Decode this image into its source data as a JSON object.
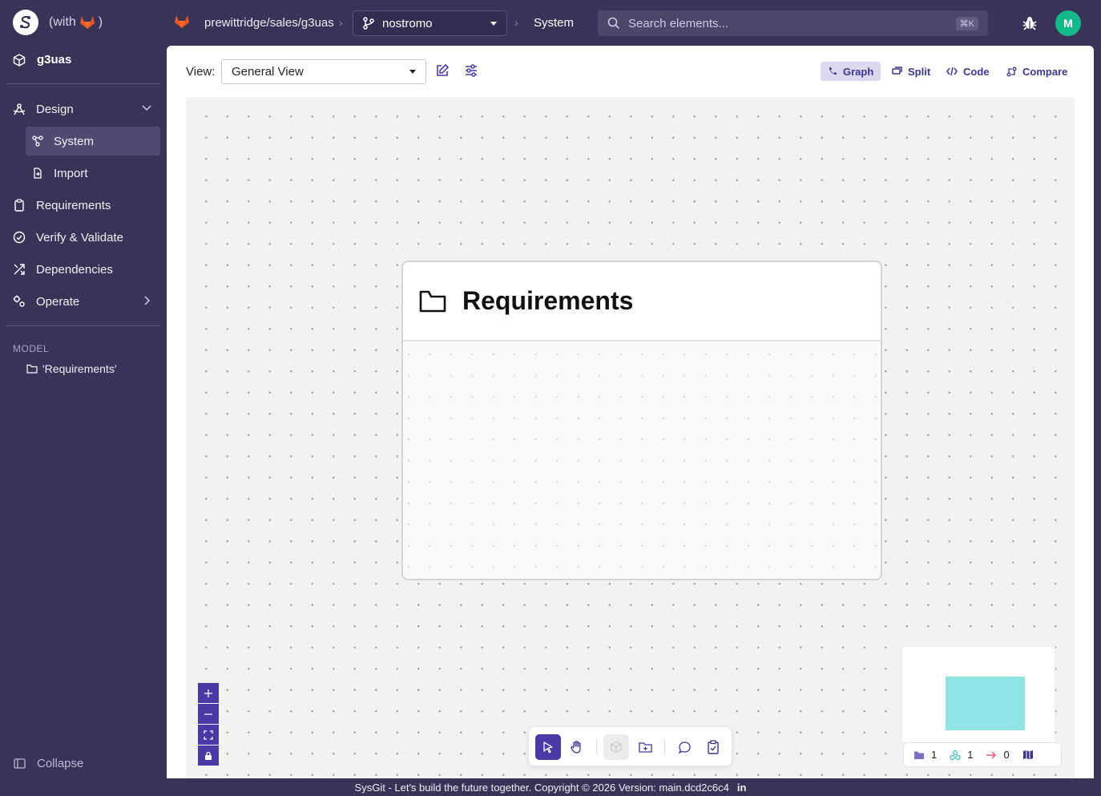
{
  "app": {
    "with_label_open": "(with",
    "with_label_close": ")"
  },
  "topbar": {
    "repo_path": "prewittridge/sales/g3uas",
    "branch": "nostromo",
    "breadcrumb_current": "System",
    "search_placeholder": "Search elements...",
    "search_shortcut": "⌘K",
    "avatar_initial": "M"
  },
  "sidebar": {
    "project": "g3uas",
    "items": [
      {
        "label": "Design"
      },
      {
        "label": "System"
      },
      {
        "label": "Import"
      },
      {
        "label": "Requirements"
      },
      {
        "label": "Verify & Validate"
      },
      {
        "label": "Dependencies"
      },
      {
        "label": "Operate"
      }
    ],
    "model_heading": "MODEL",
    "model_items": [
      {
        "label": "'Requirements'"
      }
    ],
    "collapse_label": "Collapse"
  },
  "toolbar": {
    "view_label": "View:",
    "view_selected": "General View",
    "modes": [
      {
        "label": "Graph",
        "active": true
      },
      {
        "label": "Split"
      },
      {
        "label": "Code"
      },
      {
        "label": "Compare"
      }
    ]
  },
  "canvas": {
    "package_title": "Requirements",
    "stats": {
      "packages": "1",
      "elements": "1",
      "relations": "0"
    }
  },
  "footer": {
    "text": "SysGit - Let's build the future together.  Copyright © 2026  Version: main.dcd2c6c4",
    "linkedin": "in"
  },
  "colors": {
    "sidebar_bg": "#3a3358",
    "accent": "#4b3aa6",
    "avatar": "#13b98a",
    "gitlab": "#e8562a",
    "minimap_node": "#8fe4e4"
  }
}
